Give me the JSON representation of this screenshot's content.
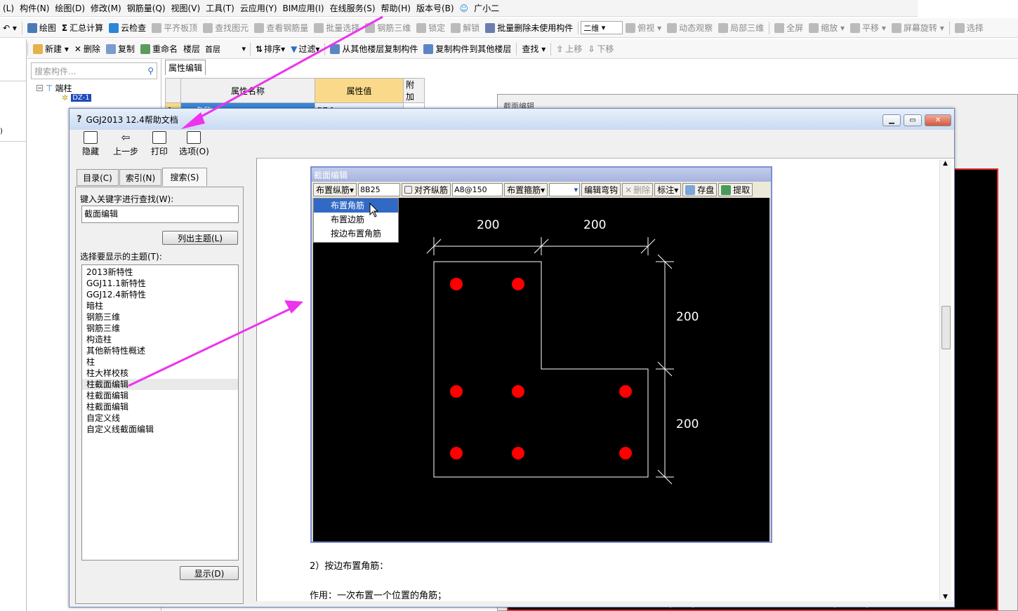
{
  "menubar": [
    "(L)",
    "构件(N)",
    "绘图(D)",
    "修改(M)",
    "钢筋量(Q)",
    "视图(V)",
    "工具(T)",
    "云应用(Y)",
    "BIM应用(I)",
    "在线服务(S)",
    "帮助(H)",
    "版本号(B)",
    "广小二"
  ],
  "toolbar1": {
    "draw": "绘图",
    "sum": "汇总计算",
    "cloud_check": "云检查",
    "flat_slab": "平齐板顶",
    "find_elem": "查找图元",
    "view_rebar": "查看钢筋量",
    "batch_select": "批量选择",
    "rebar3d": "钢筋三维",
    "lock": "锁定",
    "unlock": "解锁",
    "batch_delete": "批量删除未使用构件",
    "view2d": "二维",
    "top_view": "俯视",
    "dyn_obs": "动态观察",
    "local3d": "局部三维",
    "fullscreen": "全屏",
    "zoom": "缩放",
    "pan": "平移",
    "screen_rotate": "屏幕旋转",
    "select": "选择"
  },
  "toolbar2": {
    "new": "新建",
    "delete": "删除",
    "copy": "复制",
    "rename": "重命名",
    "floor_label": "楼层",
    "floor_value": "首层",
    "sort": "排序",
    "filter": "过滤",
    "copy_from": "从其他楼层复制构件",
    "copy_to": "复制构件到其他楼层",
    "find": "查找",
    "move_up": "上移",
    "move_down": "下移"
  },
  "left_panel": {
    "search_placeholder": "搜索构件...",
    "tree_root": "端柱",
    "tree_child": "DZ-1"
  },
  "property_panel": {
    "tab": "属性编辑",
    "headers": [
      "属性名称",
      "属性值",
      "附加"
    ],
    "row_no": "1",
    "row_name": "名称",
    "row_value": "DZ-1"
  },
  "back_window_title": "截面编辑",
  "help_window": {
    "title": "GGJ2013 12.4帮助文档",
    "buttons": {
      "hide": "隐藏",
      "back": "上一步",
      "print": "打印",
      "options": "选项(O)"
    },
    "tabs": {
      "contents": "目录(C)",
      "index": "索引(N)",
      "search": "搜索(S)"
    },
    "keyword_label": "键入关键字进行查找(W):",
    "keyword_value": "截面编辑",
    "list_topics_button": "列出主题(L)",
    "select_topic_label": "选择要显示的主题(T):",
    "topics": [
      "2013新特性",
      "GGJ11.1新特性",
      "GGJ12.4新特性",
      "暗柱",
      "钢筋三维",
      "钢筋三维",
      "构造柱",
      "其他新特性概述",
      "柱",
      "柱大样校核",
      "柱截面编辑",
      "柱截面编辑",
      "柱截面编辑",
      "自定义线",
      "自定义线截面编辑"
    ],
    "display_button": "显示(D)",
    "paragraph1": "2）按边布置角筋：",
    "paragraph2": "作用：一次布置一个位置的角筋；"
  },
  "section_editor": {
    "title": "截面编辑",
    "place_long": "布置纵筋",
    "rebar_value": "8B25",
    "align_long": "对齐纵筋",
    "stirrup_value": "A8@150",
    "place_stirrup": "布置箍筋",
    "edit_hook": "编辑弯钩",
    "delete": "删除",
    "annotate": "标注",
    "save": "存盘",
    "extract": "提取",
    "menu": [
      "布置角筋",
      "布置边筋",
      "按边布置角筋"
    ],
    "dims": [
      "200",
      "200",
      "200",
      "200"
    ]
  },
  "colors": {
    "rebar": "#ff0000",
    "arrow": "#ee33ee",
    "highlight": "#316ac5"
  }
}
